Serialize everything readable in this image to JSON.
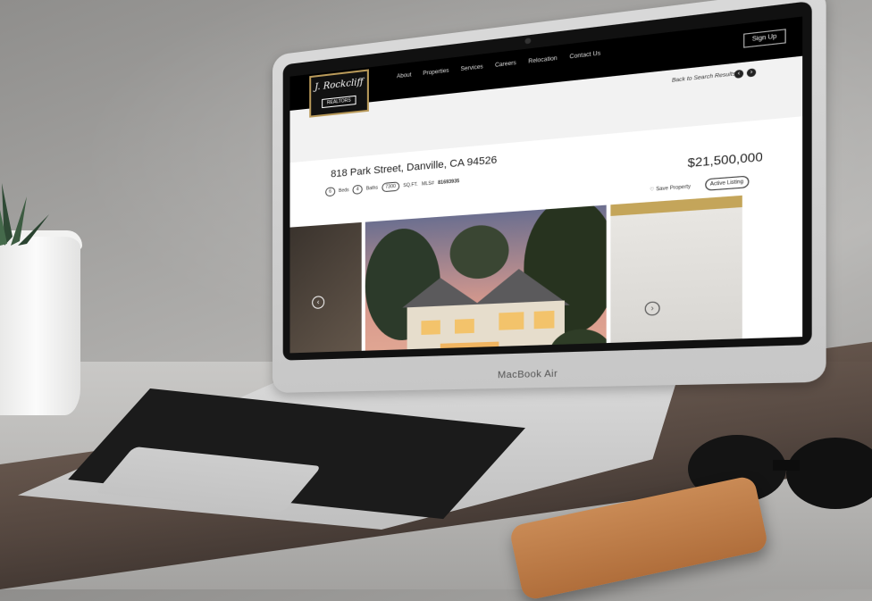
{
  "laptop": {
    "brand_label": "MacBook Air"
  },
  "site": {
    "logo": {
      "name": "J. Rockcliff",
      "sub": "REALTORS"
    },
    "nav": [
      "About",
      "Properties",
      "Services",
      "Careers",
      "Relocation",
      "Contact Us"
    ],
    "signup": "Sign Up",
    "back_link": "Back to Search Results",
    "address": "818 Park Street, Danville, CA 94526",
    "price": "$21,500,000",
    "beds": {
      "value": "6",
      "unit": "Beds"
    },
    "baths": {
      "value": "4",
      "unit": "Baths"
    },
    "sqft": {
      "value": "7300",
      "unit": "SQ.FT."
    },
    "mls": {
      "label": "MLS#",
      "value": "81693935"
    },
    "save": "Save Property",
    "status": "Active Listing"
  }
}
